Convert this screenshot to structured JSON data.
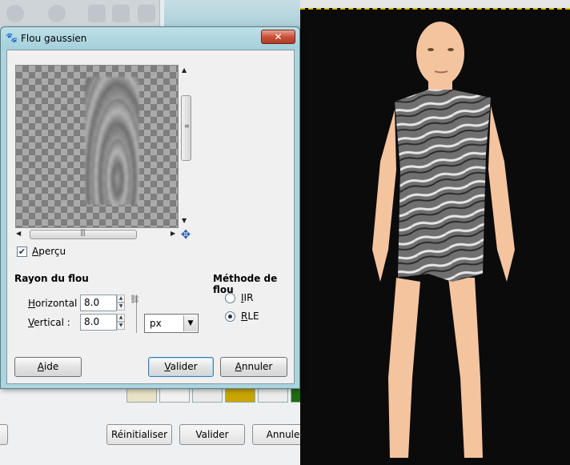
{
  "dialog": {
    "title": "Flou gaussien",
    "close_label": "✕"
  },
  "preview": {
    "checkbox_label": "Aperçu",
    "checked": true
  },
  "blur_radius": {
    "title": "Rayon du flou",
    "horizontal_label": "Horizontal :",
    "horizontal_value": "8.0",
    "vertical_label": "Vertical :",
    "vertical_value": "8.0",
    "unit": "px"
  },
  "blur_method": {
    "title": "Méthode de flou",
    "options": [
      {
        "label": "IIR",
        "selected": false
      },
      {
        "label": "RLE",
        "selected": true
      }
    ]
  },
  "buttons": {
    "help": "Aide",
    "ok": "Valider",
    "cancel": "Annuler"
  },
  "background_window": {
    "reset": "Réinitialiser",
    "ok": "Valider",
    "cancel": "Annuler",
    "mini_close": "✕",
    "swatch_colors": [
      "#e7e1c6",
      "#f2f2f2",
      "#e9e9e9",
      "#c8a500",
      "#ececec",
      "#1f6b10"
    ]
  }
}
